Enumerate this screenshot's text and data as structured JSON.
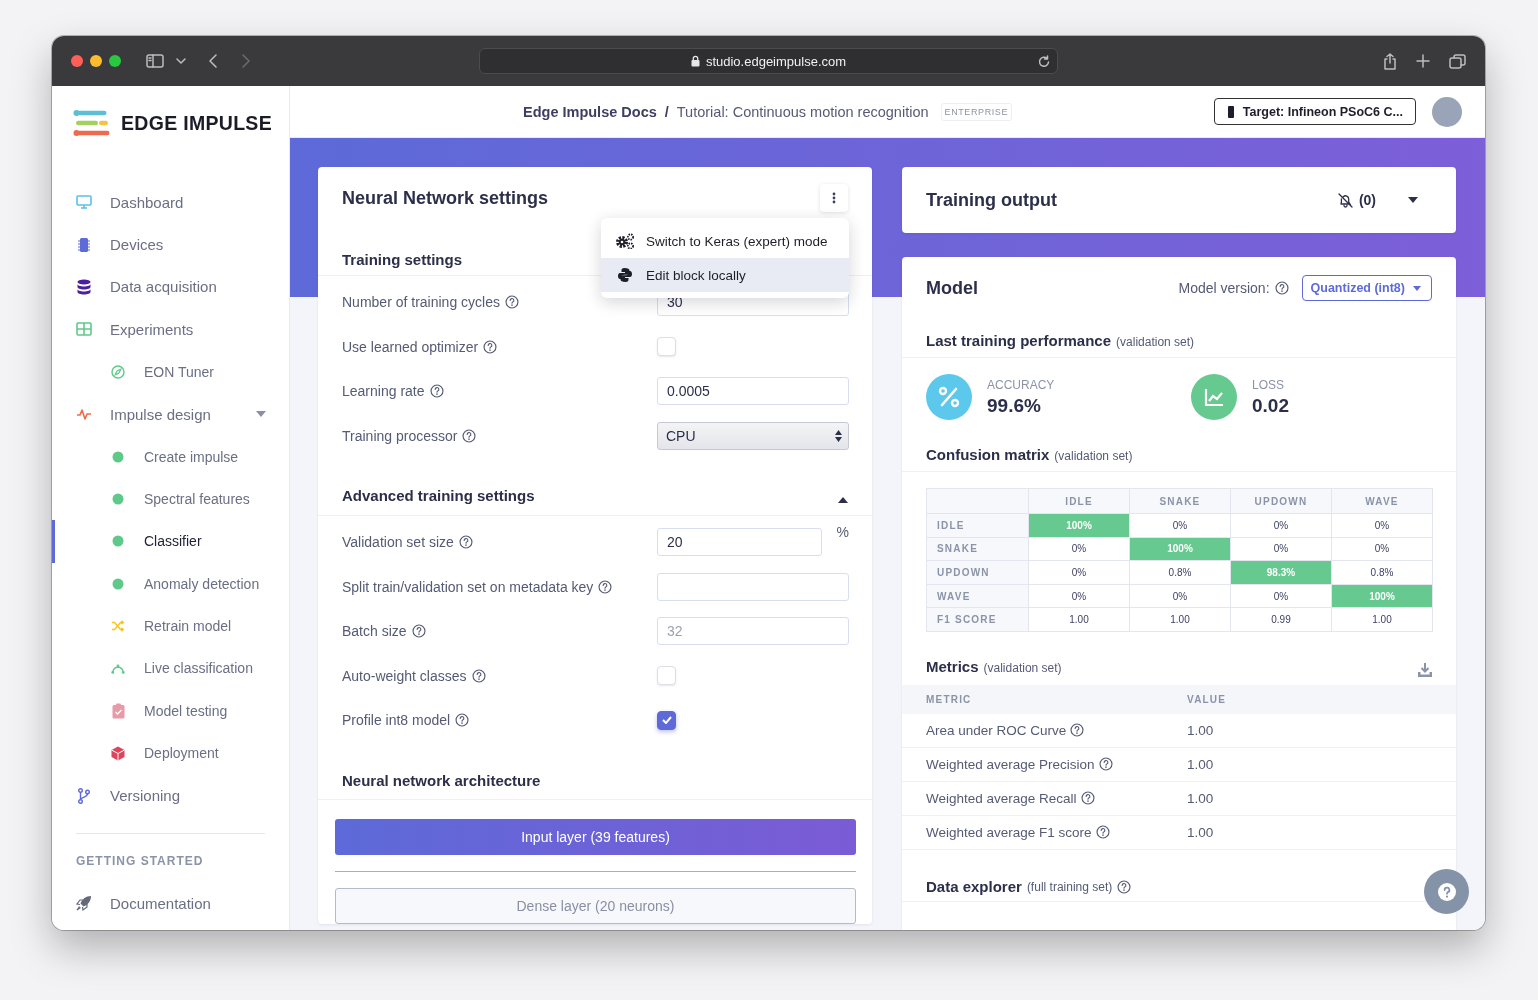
{
  "browser": {
    "url": "studio.edgeimpulse.com"
  },
  "sidebar": {
    "logo": "EDGE IMPULSE",
    "items": [
      {
        "label": "Dashboard",
        "selected": false
      },
      {
        "label": "Devices",
        "selected": false
      },
      {
        "label": "Data acquisition",
        "selected": false
      },
      {
        "label": "Experiments",
        "selected": false,
        "children": [
          {
            "label": "EON Tuner",
            "selected": false
          }
        ]
      },
      {
        "label": "Impulse design",
        "selected": false,
        "expanded": true,
        "children": [
          {
            "label": "Create impulse",
            "selected": false
          },
          {
            "label": "Spectral features",
            "selected": false
          },
          {
            "label": "Classifier",
            "selected": true
          },
          {
            "label": "Anomaly detection",
            "selected": false
          },
          {
            "label": "Retrain model",
            "selected": false
          },
          {
            "label": "Live classification",
            "selected": false
          },
          {
            "label": "Model testing",
            "selected": false
          },
          {
            "label": "Deployment",
            "selected": false
          }
        ]
      },
      {
        "label": "Versioning",
        "selected": false
      }
    ],
    "section": "GETTING STARTED",
    "footer_items": [
      {
        "label": "Documentation",
        "selected": false
      }
    ]
  },
  "header": {
    "breadcrumb": [
      {
        "label": "Edge Impulse Docs"
      },
      {
        "label": "Tutorial: Continuous motion recognition"
      }
    ],
    "separator": "/",
    "badge": "ENTERPRISE",
    "target_button": "Target: Infineon PSoC6 C..."
  },
  "nn_settings": {
    "title": "Neural Network settings",
    "menu": {
      "open": true,
      "items": [
        {
          "label": "Switch to Keras (expert) mode",
          "selected": false
        },
        {
          "label": "Edit block locally",
          "selected": true
        }
      ]
    },
    "sections": [
      {
        "title": "Training settings",
        "fields": [
          {
            "kind": "input",
            "label": "Number of training cycles",
            "value": "30"
          },
          {
            "kind": "checkbox",
            "label": "Use learned optimizer",
            "checked": false
          },
          {
            "kind": "input",
            "label": "Learning rate",
            "value": "0.0005"
          },
          {
            "kind": "select",
            "label": "Training processor",
            "value": "CPU"
          }
        ]
      },
      {
        "title": "Advanced training settings",
        "expanded": true,
        "fields": [
          {
            "kind": "input",
            "label": "Validation set size",
            "value": "20",
            "suffix": "%"
          },
          {
            "kind": "input",
            "label": "Split train/validation set on metadata key"
          },
          {
            "kind": "input",
            "label": "Batch size",
            "placeholder": "32"
          },
          {
            "kind": "checkbox",
            "label": "Auto-weight classes",
            "checked": false
          },
          {
            "kind": "checkbox",
            "label": "Profile int8 model",
            "checked": true
          }
        ]
      }
    ],
    "architecture": {
      "title": "Neural network architecture",
      "layers": [
        {
          "kind": "input",
          "label": "Input layer (39 features)"
        },
        {
          "kind": "dense",
          "label": "Dense layer (20 neurons)"
        }
      ]
    }
  },
  "training_output": {
    "title": "Training output",
    "notifications": "(0)",
    "expanded": false
  },
  "model": {
    "title": "Model",
    "version_label": "Model version:",
    "version": "Quantized (int8)",
    "performance": {
      "title": "Last training performance",
      "note": "(validation set)",
      "stats": [
        {
          "kind": "accuracy",
          "label": "ACCURACY",
          "value": "99.6%",
          "color": "#5bc8ec"
        },
        {
          "kind": "loss",
          "label": "LOSS",
          "value": "0.02",
          "color": "#66c98f"
        }
      ]
    },
    "confusion_matrix": {
      "title": "Confusion matrix",
      "note": "(validation set)",
      "columns": [
        "IDLE",
        "SNAKE",
        "UPDOWN",
        "WAVE"
      ],
      "rows": [
        {
          "label": "IDLE",
          "cells": [
            {
              "value": "100%",
              "highlighted": true
            },
            {
              "value": "0%",
              "highlighted": false
            },
            {
              "value": "0%",
              "highlighted": false
            },
            {
              "value": "0%",
              "highlighted": false
            }
          ]
        },
        {
          "label": "SNAKE",
          "cells": [
            {
              "value": "0%",
              "highlighted": false
            },
            {
              "value": "100%",
              "highlighted": true
            },
            {
              "value": "0%",
              "highlighted": false
            },
            {
              "value": "0%",
              "highlighted": false
            }
          ]
        },
        {
          "label": "UPDOWN",
          "cells": [
            {
              "value": "0%",
              "highlighted": false
            },
            {
              "value": "0.8%",
              "highlighted": false
            },
            {
              "value": "98.3%",
              "highlighted": true
            },
            {
              "value": "0.8%",
              "highlighted": false
            }
          ]
        },
        {
          "label": "WAVE",
          "cells": [
            {
              "value": "0%",
              "highlighted": false
            },
            {
              "value": "0%",
              "highlighted": false
            },
            {
              "value": "0%",
              "highlighted": false
            },
            {
              "value": "100%",
              "highlighted": true
            }
          ]
        },
        {
          "label": "F1 SCORE",
          "cells": [
            {
              "value": "1.00",
              "highlighted": false
            },
            {
              "value": "1.00",
              "highlighted": false
            },
            {
              "value": "0.99",
              "highlighted": false
            },
            {
              "value": "1.00",
              "highlighted": false
            }
          ]
        }
      ]
    },
    "metrics": {
      "title": "Metrics",
      "note": "(validation set)",
      "columns": [
        "METRIC",
        "VALUE"
      ],
      "rows": [
        {
          "label": "Area under ROC Curve",
          "value": "1.00"
        },
        {
          "label": "Weighted average Precision",
          "value": "1.00"
        },
        {
          "label": "Weighted average Recall",
          "value": "1.00"
        },
        {
          "label": "Weighted average F1 score",
          "value": "1.00"
        }
      ]
    },
    "data_explorer": {
      "title": "Data explorer",
      "note": "(full training set)"
    }
  }
}
